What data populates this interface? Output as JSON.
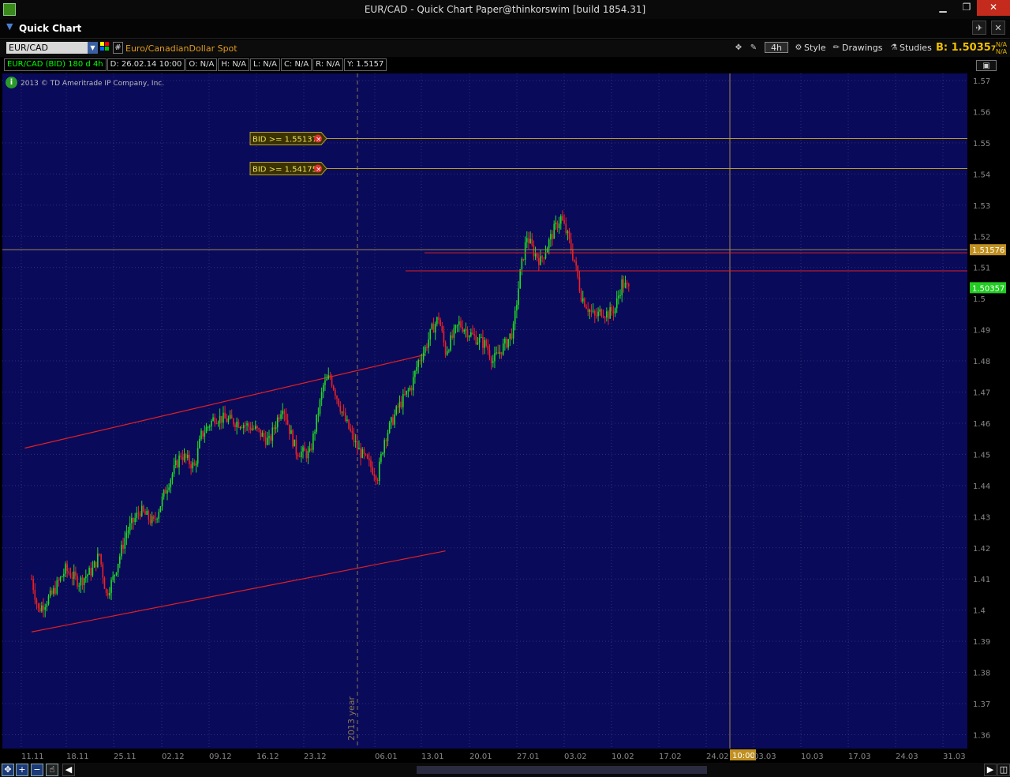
{
  "window": {
    "title": "EUR/CAD - Quick Chart Paper@thinkorswim [build 1854.31]",
    "minimize": "▁",
    "maximize": "❐",
    "close": "✕"
  },
  "quick": {
    "title": "Quick Chart",
    "pin": "✈",
    "close": "✕"
  },
  "toolbar": {
    "symbol": "EUR/CAD",
    "description": "Euro/CanadianDollar Spot",
    "aggregation": "4h",
    "style": "Style",
    "drawings": "Drawings",
    "studies": "Studies",
    "bid_label": "B: 1.5035",
    "bid_small": "7",
    "na1": "N/A",
    "na2": "N/A",
    "hash": "#"
  },
  "infobar": [
    "EUR/CAD (BID) 180 d 4h",
    "D: 26.02.14 10:00",
    "O: N/A",
    "H: N/A",
    "L: N/A",
    "C: N/A",
    "R: N/A",
    "Y: 1.5157"
  ],
  "copyright": "2013 © TD Ameritrade IP Company, Inc.",
  "colors": {
    "bg": "#0a0a5a",
    "up": "#22dd22",
    "down": "#ee2222",
    "grid": "#2f2f7a",
    "alert": "#b8a020",
    "year": "#8a7a50"
  },
  "chart_data": {
    "type": "candlestick",
    "symbol": "EUR/CAD (BID)",
    "aggregation": "4h",
    "y_ticks": [
      "1.57",
      "1.56",
      "1.55",
      "1.54",
      "1.53",
      "1.52",
      "1.51",
      "1.5",
      "1.49",
      "1.48",
      "1.47",
      "1.46",
      "1.45",
      "1.44",
      "1.43",
      "1.42",
      "1.41",
      "1.4",
      "1.39",
      "1.38",
      "1.37",
      "1.36"
    ],
    "ylim": [
      1.36,
      1.57
    ],
    "x_labels": [
      "11.11",
      "18.11",
      "25.11",
      "02.12",
      "09.12",
      "16.12",
      "23.12",
      "06.01",
      "13.01",
      "20.01",
      "27.01",
      "03.02",
      "10.02",
      "17.02",
      "24.02",
      "10:00",
      "03.03",
      "10.03",
      "17.03",
      "24.03",
      "31.03"
    ],
    "year_marker": "2013 year",
    "alerts": [
      {
        "label": "BID >= 1.55137",
        "value": 1.55137
      },
      {
        "label": "BID >= 1.54175",
        "value": 1.54175
      }
    ],
    "horizontal_lines": [
      {
        "value": 1.5147
      },
      {
        "value": 1.5089
      }
    ],
    "cursor_price": {
      "label": "1.5157",
      "small": "6",
      "value": 1.5157
    },
    "last_price": {
      "label": "1.5035",
      "small": "7",
      "value": 1.5035
    },
    "trendlines": [
      {
        "x_start": "10.11",
        "y_start": 1.452,
        "x_end": "08.01",
        "y_end": 1.482
      },
      {
        "x_start": "11.11",
        "y_start": 1.393,
        "x_end": "11.01",
        "y_end": 1.419
      }
    ],
    "path": [
      [
        "11.11",
        1.41
      ],
      [
        "12.11",
        1.4
      ],
      [
        "14.11",
        1.405
      ],
      [
        "16.11",
        1.413
      ],
      [
        "18.11",
        1.409
      ],
      [
        "20.11",
        1.413
      ],
      [
        "21.11",
        1.418
      ],
      [
        "22.11",
        1.405
      ],
      [
        "23.11",
        1.41
      ],
      [
        "25.11",
        1.425
      ],
      [
        "27.11",
        1.432
      ],
      [
        "29.11",
        1.428
      ],
      [
        "01.12",
        1.44
      ],
      [
        "03.12",
        1.45
      ],
      [
        "05.12",
        1.446
      ],
      [
        "06.12",
        1.456
      ],
      [
        "08.12",
        1.462
      ],
      [
        "10.12",
        1.461
      ],
      [
        "12.12",
        1.46
      ],
      [
        "14.12",
        1.458
      ],
      [
        "16.12",
        1.454
      ],
      [
        "18.12",
        1.466
      ],
      [
        "19.12",
        1.458
      ],
      [
        "20.12",
        1.451
      ],
      [
        "22.12",
        1.45
      ],
      [
        "23.12",
        1.461
      ],
      [
        "24.12",
        1.472
      ],
      [
        "25.12",
        1.475
      ],
      [
        "27.12",
        1.462
      ],
      [
        "29.12",
        1.452
      ],
      [
        "31.12",
        1.446
      ],
      [
        "01.01",
        1.443
      ],
      [
        "02.01",
        1.455
      ],
      [
        "04.01",
        1.465
      ],
      [
        "06.01",
        1.472
      ],
      [
        "07.01",
        1.48
      ],
      [
        "08.01",
        1.484
      ],
      [
        "09.01",
        1.49
      ],
      [
        "10.01",
        1.494
      ],
      [
        "11.01",
        1.483
      ],
      [
        "13.01",
        1.492
      ],
      [
        "15.01",
        1.488
      ],
      [
        "17.01",
        1.485
      ],
      [
        "18.01",
        1.48
      ],
      [
        "20.01",
        1.486
      ],
      [
        "21.01",
        1.49
      ],
      [
        "22.01",
        1.508
      ],
      [
        "23.01",
        1.52
      ],
      [
        "24.01",
        1.515
      ],
      [
        "25.01",
        1.512
      ],
      [
        "27.01",
        1.522
      ],
      [
        "28.01",
        1.526
      ],
      [
        "29.01",
        1.52
      ],
      [
        "30.01",
        1.512
      ],
      [
        "31.01",
        1.501
      ],
      [
        "01.02",
        1.497
      ],
      [
        "02.02",
        1.494
      ],
      [
        "03.02",
        1.496
      ],
      [
        "04.02",
        1.495
      ],
      [
        "05.02",
        1.497
      ],
      [
        "06.02",
        1.505
      ],
      [
        "07.02",
        1.503
      ]
    ]
  }
}
